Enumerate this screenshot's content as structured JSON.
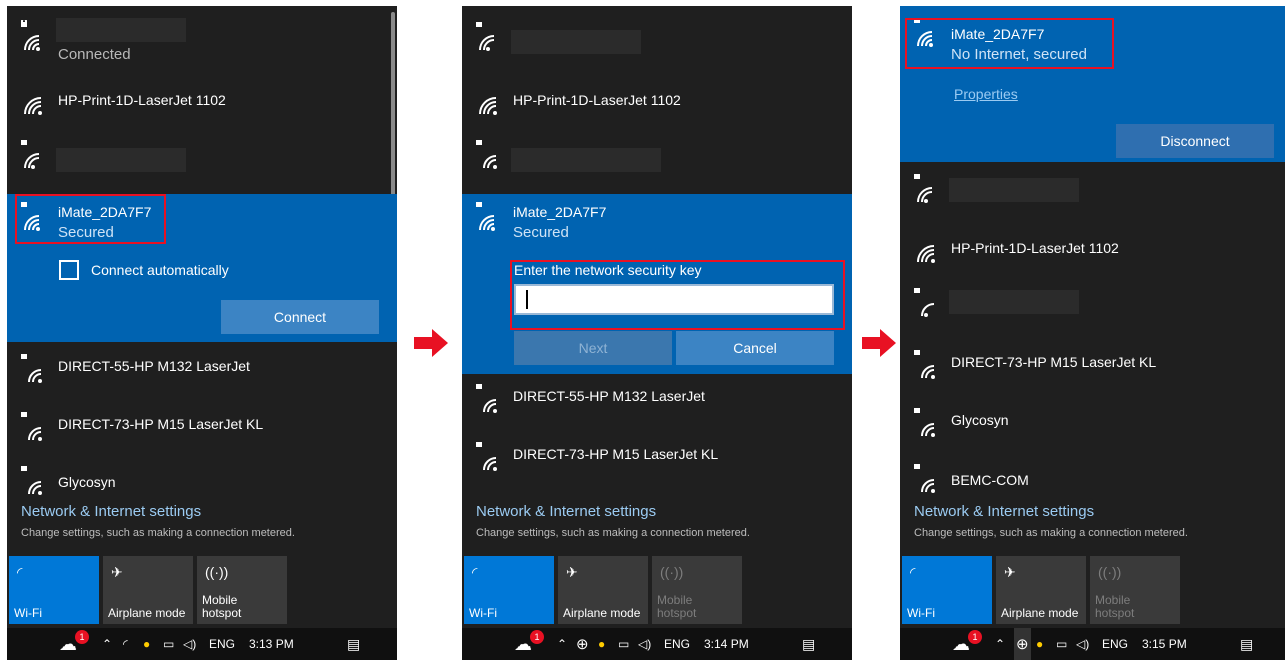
{
  "panels": [
    {
      "networks_top": [
        {
          "status": "Connected"
        },
        {
          "name": "HP-Print-1D-LaserJet 1102"
        }
      ],
      "selected": {
        "name": "iMate_2DA7F7",
        "status": "Secured",
        "connect_auto_label": "Connect automatically",
        "connect_button": "Connect"
      },
      "networks_bottom": [
        {
          "name": "DIRECT-55-HP M132 LaserJet"
        },
        {
          "name": "DIRECT-73-HP M15 LaserJet KL"
        },
        {
          "name": "Glycosyn"
        }
      ],
      "settings_title": "Network & Internet settings",
      "settings_sub": "Change settings, such as making a connection metered.",
      "tiles": [
        {
          "label": "Wi-Fi",
          "state": "on"
        },
        {
          "label": "Airplane mode",
          "state": "normal"
        },
        {
          "label": "Mobile\nhotspot",
          "state": "normal"
        }
      ],
      "taskbar": {
        "badge": "1",
        "lang": "ENG",
        "time": "3:13 PM"
      }
    },
    {
      "networks_top": [
        {
          "name": "HP-Print-1D-LaserJet 1102"
        }
      ],
      "selected": {
        "name": "iMate_2DA7F7",
        "status": "Secured",
        "key_label": "Enter the network security key",
        "key_value": "",
        "next_button": "Next",
        "cancel_button": "Cancel"
      },
      "networks_bottom": [
        {
          "name": "DIRECT-55-HP M132 LaserJet"
        },
        {
          "name": "DIRECT-73-HP M15 LaserJet KL"
        }
      ],
      "settings_title": "Network & Internet settings",
      "settings_sub": "Change settings, such as making a connection metered.",
      "tiles": [
        {
          "label": "Wi-Fi",
          "state": "on"
        },
        {
          "label": "Airplane mode",
          "state": "normal"
        },
        {
          "label": "Mobile\nhotspot",
          "state": "off"
        }
      ],
      "taskbar": {
        "badge": "1",
        "lang": "ENG",
        "time": "3:14 PM"
      }
    },
    {
      "selected": {
        "name": "iMate_2DA7F7",
        "status": "No Internet, secured",
        "properties_link": "Properties",
        "disconnect_button": "Disconnect"
      },
      "networks_bottom": [
        {
          "name": "HP-Print-1D-LaserJet 1102"
        },
        {
          "name": "DIRECT-73-HP M15 LaserJet KL"
        },
        {
          "name": "Glycosyn"
        },
        {
          "name": "BEMC-COM"
        }
      ],
      "settings_title": "Network & Internet settings",
      "settings_sub": "Change settings, such as making a connection metered.",
      "tiles": [
        {
          "label": "Wi-Fi",
          "state": "on"
        },
        {
          "label": "Airplane mode",
          "state": "normal"
        },
        {
          "label": "Mobile\nhotspot",
          "state": "off"
        }
      ],
      "taskbar": {
        "badge": "1",
        "lang": "ENG",
        "time": "3:15 PM"
      }
    }
  ],
  "colors": {
    "panel_bg": "#1f1f1f",
    "selected_bg": "#0063b1",
    "accent": "#0078d7",
    "highlight_box": "#e81123",
    "arrow": "#e81123"
  }
}
